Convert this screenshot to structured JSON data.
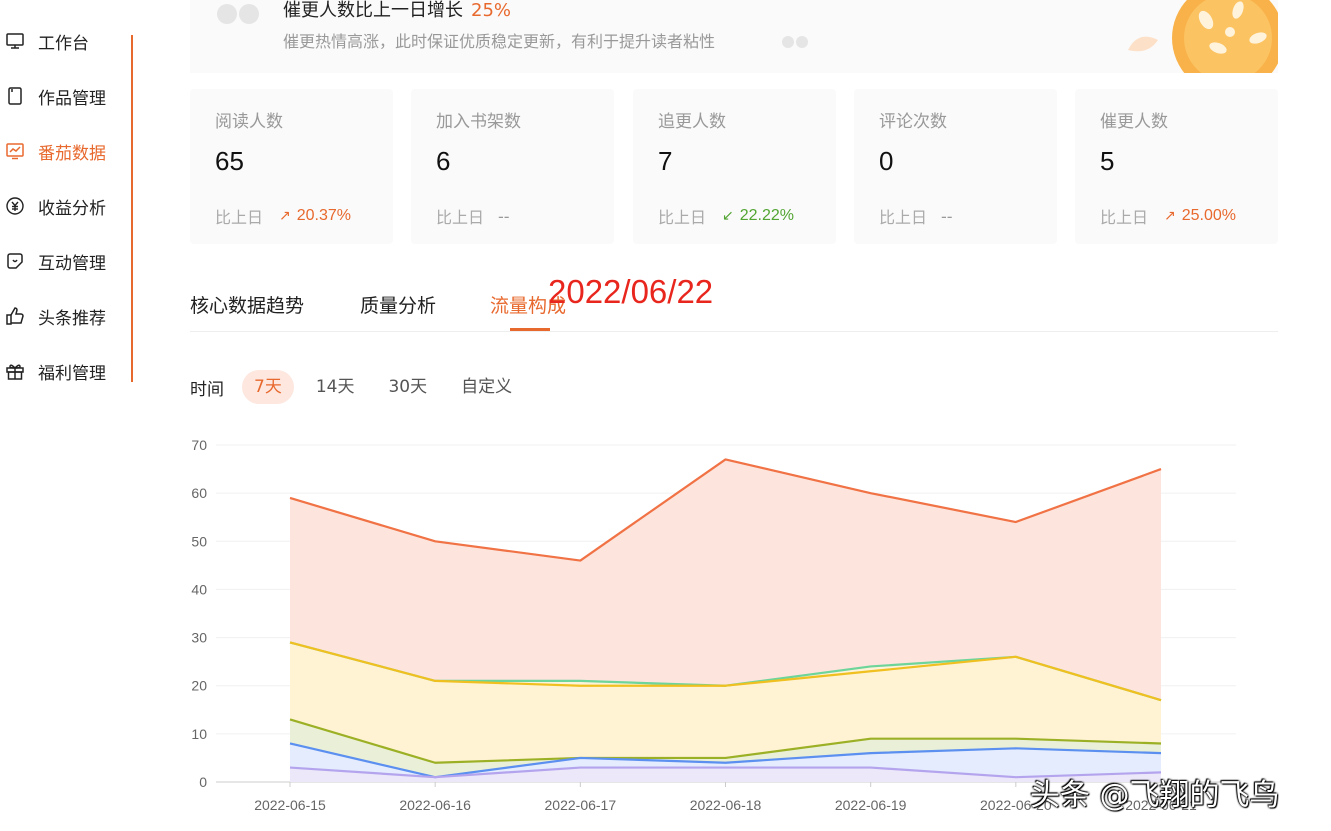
{
  "sidebar": {
    "items": [
      {
        "label": "工作台",
        "icon": "monitor-icon"
      },
      {
        "label": "作品管理",
        "icon": "book-icon"
      },
      {
        "label": "番茄数据",
        "icon": "chart-icon"
      },
      {
        "label": "收益分析",
        "icon": "yuan-icon"
      },
      {
        "label": "互动管理",
        "icon": "chat-icon"
      },
      {
        "label": "头条推荐",
        "icon": "thumbs-up-icon"
      },
      {
        "label": "福利管理",
        "icon": "gift-icon"
      }
    ],
    "active_index": 2
  },
  "banner": {
    "headline": "催更人数比上一日增长",
    "headline_value": "25%",
    "subtitle": "催更热情高涨，此时保证优质稳定更新，有利于提升读者粘性"
  },
  "stats": [
    {
      "label": "阅读人数",
      "value": "65",
      "compare_label": "比上日",
      "trend": "up",
      "change": "20.37%"
    },
    {
      "label": "加入书架数",
      "value": "6",
      "compare_label": "比上日",
      "trend": "none",
      "change": "--"
    },
    {
      "label": "追更人数",
      "value": "7",
      "compare_label": "比上日",
      "trend": "down",
      "change": "22.22%"
    },
    {
      "label": "评论次数",
      "value": "0",
      "compare_label": "比上日",
      "trend": "none",
      "change": "--"
    },
    {
      "label": "催更人数",
      "value": "5",
      "compare_label": "比上日",
      "trend": "up",
      "change": "25.00%"
    }
  ],
  "tabs": {
    "items": [
      "核心数据趋势",
      "质量分析",
      "流量构成"
    ],
    "active_index": 2
  },
  "date_overlay": "2022/06/22",
  "time_filter": {
    "label": "时间",
    "options": [
      "7天",
      "14天",
      "30天",
      "自定义"
    ],
    "active_index": 0
  },
  "colors": {
    "accent": "#e8692e",
    "up": "#e8692e",
    "down": "#52a532",
    "overlay": "#e8261d"
  },
  "chart_data": {
    "type": "area",
    "x": [
      "2022-06-15",
      "2022-06-16",
      "2022-06-17",
      "2022-06-18",
      "2022-06-19",
      "2022-06-20",
      "2022-06-21"
    ],
    "ylim": [
      0,
      70
    ],
    "yticks": [
      0,
      10,
      20,
      30,
      40,
      50,
      60,
      70
    ],
    "grid": true,
    "series": [
      {
        "values": [
          59,
          50,
          46,
          67,
          60,
          54,
          65
        ],
        "color": "#f07245",
        "fill": "#fde5dd"
      },
      {
        "values": [
          29,
          21,
          21,
          20,
          24,
          26,
          17
        ],
        "color": "#6dd49a",
        "fill": "#fdf3d8"
      },
      {
        "values": [
          29,
          21,
          20,
          20,
          23,
          26,
          17
        ],
        "color": "#f0c020",
        "fill": "#fff3d4"
      },
      {
        "values": [
          13,
          4,
          5,
          5,
          9,
          9,
          8
        ],
        "color": "#9cb025",
        "fill": "#eaf0d8"
      },
      {
        "values": [
          8,
          1,
          5,
          4,
          6,
          7,
          6
        ],
        "color": "#5b8ff0",
        "fill": "#e4ecfd"
      },
      {
        "values": [
          3,
          1,
          3,
          3,
          3,
          1,
          2
        ],
        "color": "#b4a4ee",
        "fill": "#ece8fa"
      }
    ]
  },
  "watermark": "头条 @飞翔的飞鸟"
}
